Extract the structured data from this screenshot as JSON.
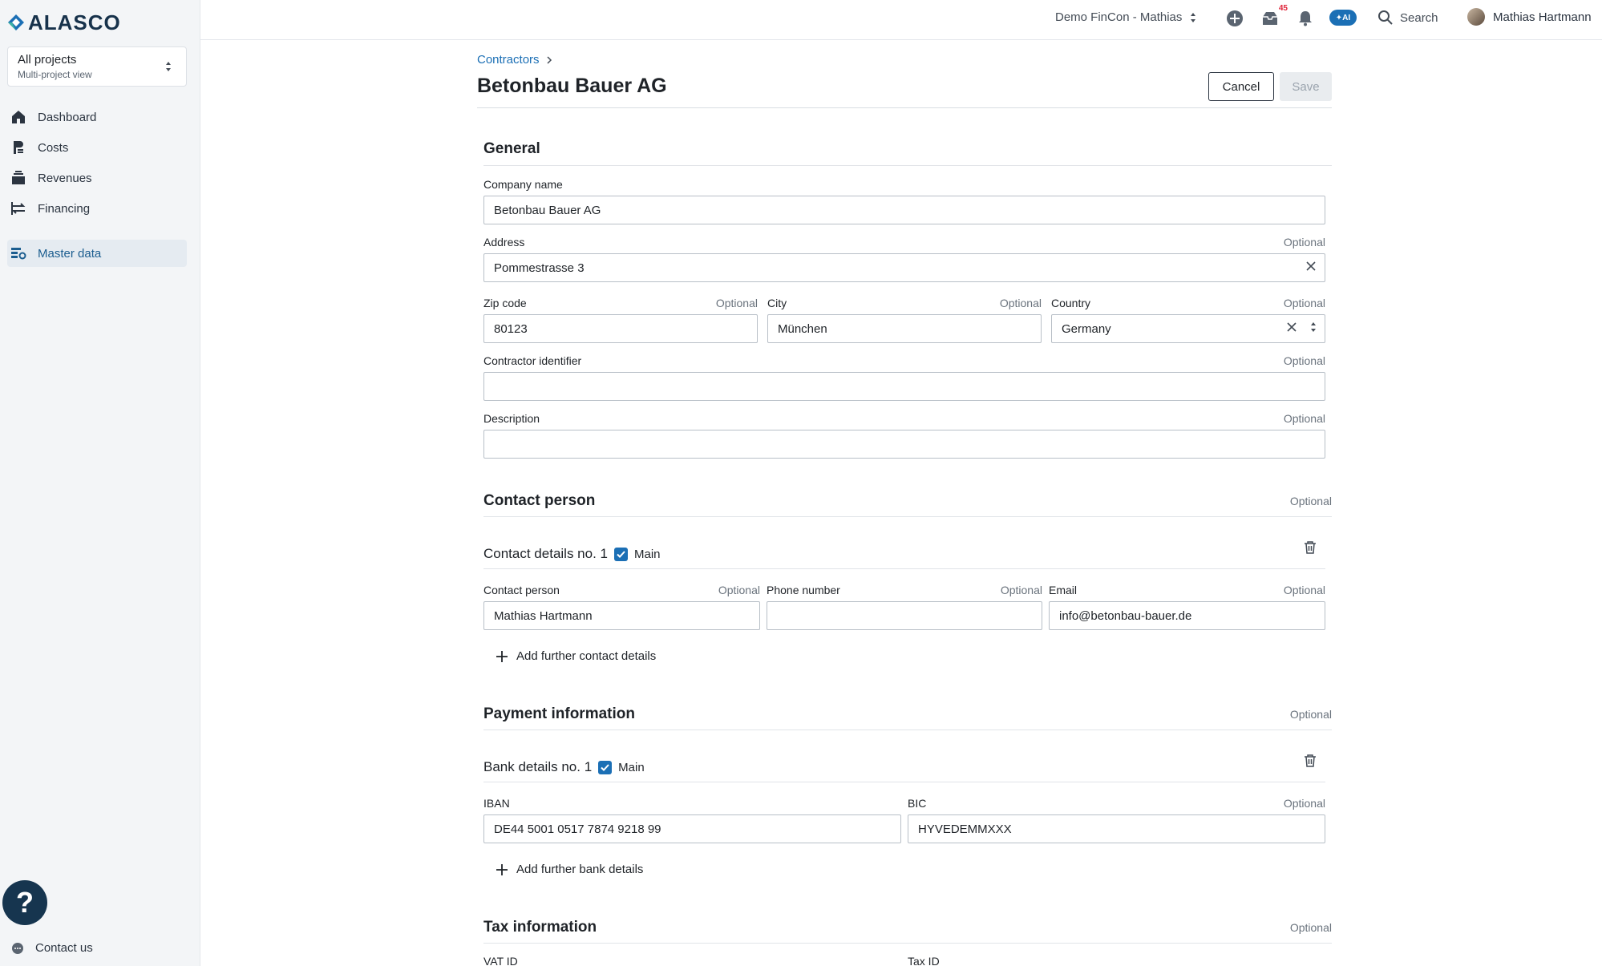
{
  "brand": {
    "name": "ALASCO"
  },
  "project_selector": {
    "title": "All projects",
    "subtitle": "Multi-project view"
  },
  "sidebar": {
    "items": [
      {
        "label": "Dashboard",
        "icon": "home-icon"
      },
      {
        "label": "Costs",
        "icon": "costs-icon"
      },
      {
        "label": "Revenues",
        "icon": "revenues-icon"
      },
      {
        "label": "Financing",
        "icon": "financing-icon"
      }
    ],
    "master": {
      "label": "Master data",
      "icon": "master-data-icon"
    },
    "help_label": "?",
    "contact_label": "Contact us"
  },
  "topbar": {
    "tenant": "Demo FinCon - Mathias",
    "inbox_count": "45",
    "ai_label": "✦AI",
    "search_label": "Search",
    "user_name": "Mathias Hartmann"
  },
  "breadcrumb": {
    "parent": "Contractors"
  },
  "page": {
    "title": "Betonbau Bauer AG",
    "cancel_label": "Cancel",
    "save_label": "Save"
  },
  "optional_label": "Optional",
  "general": {
    "title": "General",
    "company_label": "Company name",
    "company_value": "Betonbau Bauer AG",
    "address_label": "Address",
    "address_value": "Pommestrasse 3",
    "zip_label": "Zip code",
    "zip_value": "80123",
    "city_label": "City",
    "city_value": "München",
    "country_label": "Country",
    "country_value": "Germany",
    "identifier_label": "Contractor identifier",
    "identifier_value": "",
    "description_label": "Description",
    "description_value": ""
  },
  "contact": {
    "title": "Contact person",
    "details_title": "Contact details no. 1",
    "main_label": "Main",
    "person_label": "Contact person",
    "person_value": "Mathias Hartmann",
    "phone_label": "Phone number",
    "phone_value": "",
    "email_label": "Email",
    "email_value": "info@betonbau-bauer.de",
    "add_label": "Add further contact details"
  },
  "payment": {
    "title": "Payment information",
    "details_title": "Bank details no. 1",
    "main_label": "Main",
    "iban_label": "IBAN",
    "iban_value": "DE44 5001 0517 7874 9218 99",
    "bic_label": "BIC",
    "bic_value": "HYVEDEMMXXX",
    "add_label": "Add further bank details"
  },
  "tax": {
    "title": "Tax information",
    "vat_label": "VAT ID",
    "taxid_label": "Tax ID"
  }
}
